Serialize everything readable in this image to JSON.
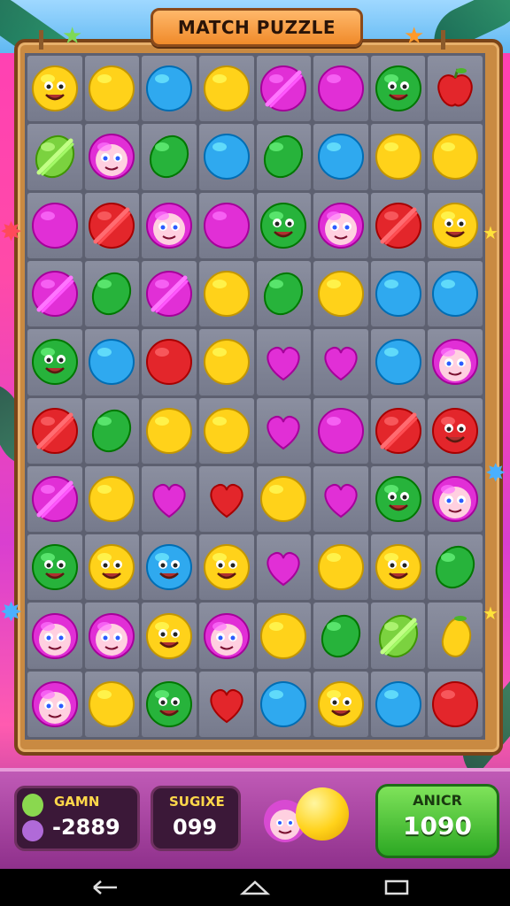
{
  "title": "MATCH PUZZLE",
  "colors": {
    "yellow": "#ffd21a",
    "blue": "#2fa9ef",
    "green": "#27b33b",
    "magenta": "#e12fd6",
    "red": "#e3262b",
    "lime": "#7bd23f"
  },
  "grid": [
    [
      "yellow-face",
      "yellow",
      "blue",
      "yellow",
      "magenta-striped",
      "magenta",
      "green-face",
      "red-apple"
    ],
    [
      "lime-striped",
      "pink-face",
      "green",
      "blue",
      "green",
      "blue",
      "yellow",
      "yellow"
    ],
    [
      "magenta",
      "red-striped",
      "pink-face",
      "magenta",
      "green-face",
      "pink-face",
      "red-striped",
      "yellow-face"
    ],
    [
      "magenta-striped",
      "green",
      "magenta-striped",
      "yellow",
      "green",
      "yellow",
      "blue",
      "blue"
    ],
    [
      "green-face",
      "blue",
      "red",
      "yellow",
      "magenta-heart",
      "magenta-heart",
      "blue",
      "pink-face"
    ],
    [
      "red-striped",
      "green",
      "yellow",
      "yellow",
      "magenta-heart",
      "magenta",
      "red-striped",
      "red-face"
    ],
    [
      "magenta-striped",
      "yellow",
      "magenta-heart",
      "red-heart",
      "yellow",
      "magenta-heart",
      "green-face",
      "pink-face"
    ],
    [
      "green-face",
      "yellow-face",
      "blue-face",
      "yellow-face",
      "magenta-heart",
      "yellow",
      "yellow-face",
      "green"
    ],
    [
      "pink-face",
      "pink-face",
      "yellow-face",
      "pink-face",
      "yellow",
      "green",
      "lime-striped",
      "yellow-mango"
    ],
    [
      "pink-face",
      "yellow",
      "green-face",
      "red-heart",
      "blue",
      "yellow-face",
      "blue",
      "red"
    ]
  ],
  "hud": {
    "left_label": "GAMN",
    "left_value": "-2889",
    "middle_label": "SUGIXE",
    "middle_value": "099",
    "right_label": "ANICR",
    "right_value": "1090"
  },
  "nav": {
    "back_icon": "back-icon",
    "home_icon": "home-icon",
    "recents_icon": "recents-icon"
  }
}
